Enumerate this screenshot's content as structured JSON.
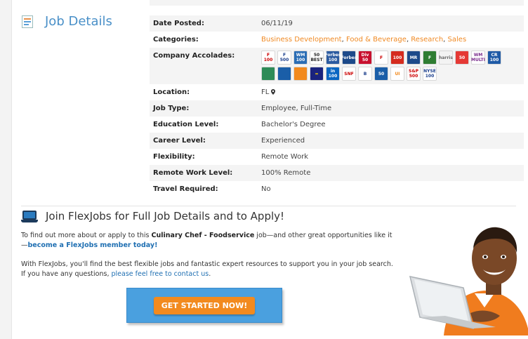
{
  "sidebar": {
    "title": "Job Details"
  },
  "details": [
    {
      "key": "Date Posted:",
      "value": "06/11/19"
    },
    {
      "key": "Categories:",
      "links": [
        "Business Development",
        "Food & Beverage",
        "Research",
        "Sales"
      ]
    },
    {
      "key": "Company Accolades:"
    },
    {
      "key": "Location:",
      "value": "FL"
    },
    {
      "key": "Job Type:",
      "value": "Employee, Full-Time"
    },
    {
      "key": "Education Level:",
      "value": "Bachelor's Degree"
    },
    {
      "key": "Career Level:",
      "value": "Experienced"
    },
    {
      "key": "Flexibility:",
      "value": "Remote Work"
    },
    {
      "key": "Remote Work Level:",
      "value": "100% Remote"
    },
    {
      "key": "Travel Required:",
      "value": "No"
    }
  ],
  "accolades": [
    {
      "name": "fortune-100-badge",
      "label": "F\n100",
      "color": "#ffffff",
      "text": "#c00"
    },
    {
      "name": "fortune-500-badge",
      "label": "F\n500",
      "color": "#ffffff",
      "text": "#1a3e8c"
    },
    {
      "name": "working-mother-100-badge",
      "label": "WM\n100",
      "color": "#2a6db5",
      "text": "#fff"
    },
    {
      "name": "best-50-badge",
      "label": "50\nBEST",
      "color": "#ffffff",
      "text": "#222"
    },
    {
      "name": "forbes-100-badge",
      "label": "Forbes\n100",
      "color": "#2b5aa0",
      "text": "#fff"
    },
    {
      "name": "forbes-badge",
      "label": "Forbes",
      "color": "#1d4a8a",
      "text": "#fff"
    },
    {
      "name": "diversity-badge",
      "label": "Div\n50",
      "color": "#c8102e",
      "text": "#fff"
    },
    {
      "name": "fortune-badge",
      "label": "F",
      "color": "#ffffff",
      "text": "#c00"
    },
    {
      "name": "canada-100-badge",
      "label": "100",
      "color": "#d52b1e",
      "text": "#fff"
    },
    {
      "name": "forbes-mr-badge",
      "label": "MR",
      "color": "#1d4a8a",
      "text": "#fff"
    },
    {
      "name": "forbes-green-badge",
      "label": "F",
      "color": "#2e7d32",
      "text": "#fff"
    },
    {
      "name": "harris-badge",
      "label": "harris",
      "color": "#f3f3f3",
      "text": "#6a6a6a"
    },
    {
      "name": "50-red-badge",
      "label": "50",
      "color": "#e53935",
      "text": "#fff"
    },
    {
      "name": "wm-multi-badge",
      "label": "WM\nMULTI",
      "color": "#ffffff",
      "text": "#7a2c8c"
    },
    {
      "name": "cr-100-badge",
      "label": "CR\n100",
      "color": "#1f5aa6",
      "text": "#fff"
    },
    {
      "name": "green-leaf-badge",
      "label": "",
      "color": "#2e8b57",
      "text": "#fff"
    },
    {
      "name": "circle-seal-badge",
      "label": "",
      "color": "#1a5ea8",
      "text": "#fff"
    },
    {
      "name": "orange-circle-badge",
      "label": "",
      "color": "#f28a1e",
      "text": "#fff"
    },
    {
      "name": "equality-badge",
      "label": "=",
      "color": "#1a237e",
      "text": "#ffd600"
    },
    {
      "name": "linkedin-100-badge",
      "label": "in\n100",
      "color": "#0a66c2",
      "text": "#fff"
    },
    {
      "name": "snf-badge",
      "label": "SNF",
      "color": "#ffffff",
      "text": "#c00"
    },
    {
      "name": "best-brand-badge",
      "label": "B",
      "color": "#ffffff",
      "text": "#1a3e8c"
    },
    {
      "name": "top-50-badge",
      "label": "50",
      "color": "#1a5ea8",
      "text": "#fff"
    },
    {
      "name": "ui-badge",
      "label": "UI",
      "color": "#ffffff",
      "text": "#f28a1e"
    },
    {
      "name": "sp-500-badge",
      "label": "S&P\n500",
      "color": "#ffffff",
      "text": "#c00"
    },
    {
      "name": "nyse-100-badge",
      "label": "NYSE\n100",
      "color": "#ffffff",
      "text": "#1a3e8c"
    }
  ],
  "join": {
    "title": "Join FlexJobs for Full Job Details and to Apply!",
    "p1_prefix": "To find out more about or apply to this ",
    "p1_job": "Culinary Chef - Foodservice",
    "p1_mid": " job—and other great opportunities like it—",
    "p1_link": "become a FlexJobs member today!",
    "p2_text": "With FlexJobs, you'll find the best flexible jobs and fantastic expert resources to support you in your job search. If you have any questions, ",
    "p2_link": "please feel free to contact us",
    "p2_end": ".",
    "cta": "GET STARTED NOW!"
  }
}
